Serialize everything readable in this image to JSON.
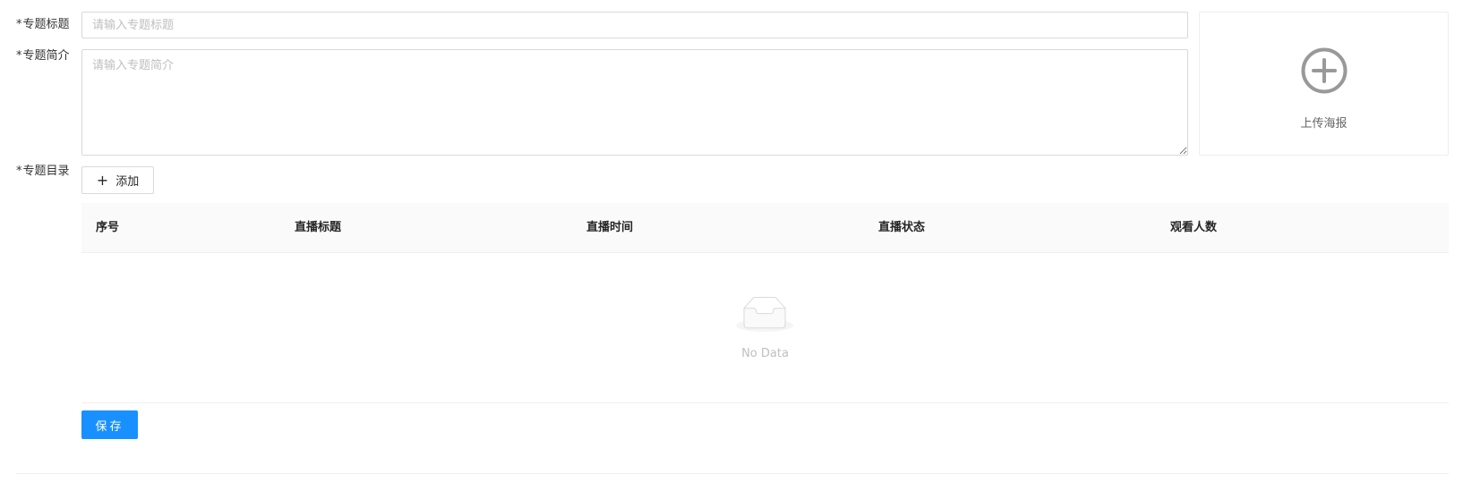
{
  "form": {
    "title_label": "专题标题",
    "title_placeholder": "请输入专题标题",
    "title_value": "",
    "intro_label": "专题简介",
    "intro_placeholder": "请输入专题简介",
    "intro_value": "",
    "catalog_label": "专题目录",
    "required_mark": "*"
  },
  "poster": {
    "upload_label": "上传海报",
    "icon": "plus-circle-icon"
  },
  "catalog": {
    "add_label": "添加",
    "add_icon": "plus-icon",
    "columns": [
      "序号",
      "直播标题",
      "直播时间",
      "直播状态",
      "观看人数"
    ],
    "rows": [],
    "empty_text": "No Data",
    "empty_icon": "inbox-icon"
  },
  "actions": {
    "save_label": "保存"
  },
  "colors": {
    "primary": "#1890ff",
    "border": "#d9d9d9",
    "header_bg": "#fafafa",
    "placeholder": "#bfbfbf"
  }
}
